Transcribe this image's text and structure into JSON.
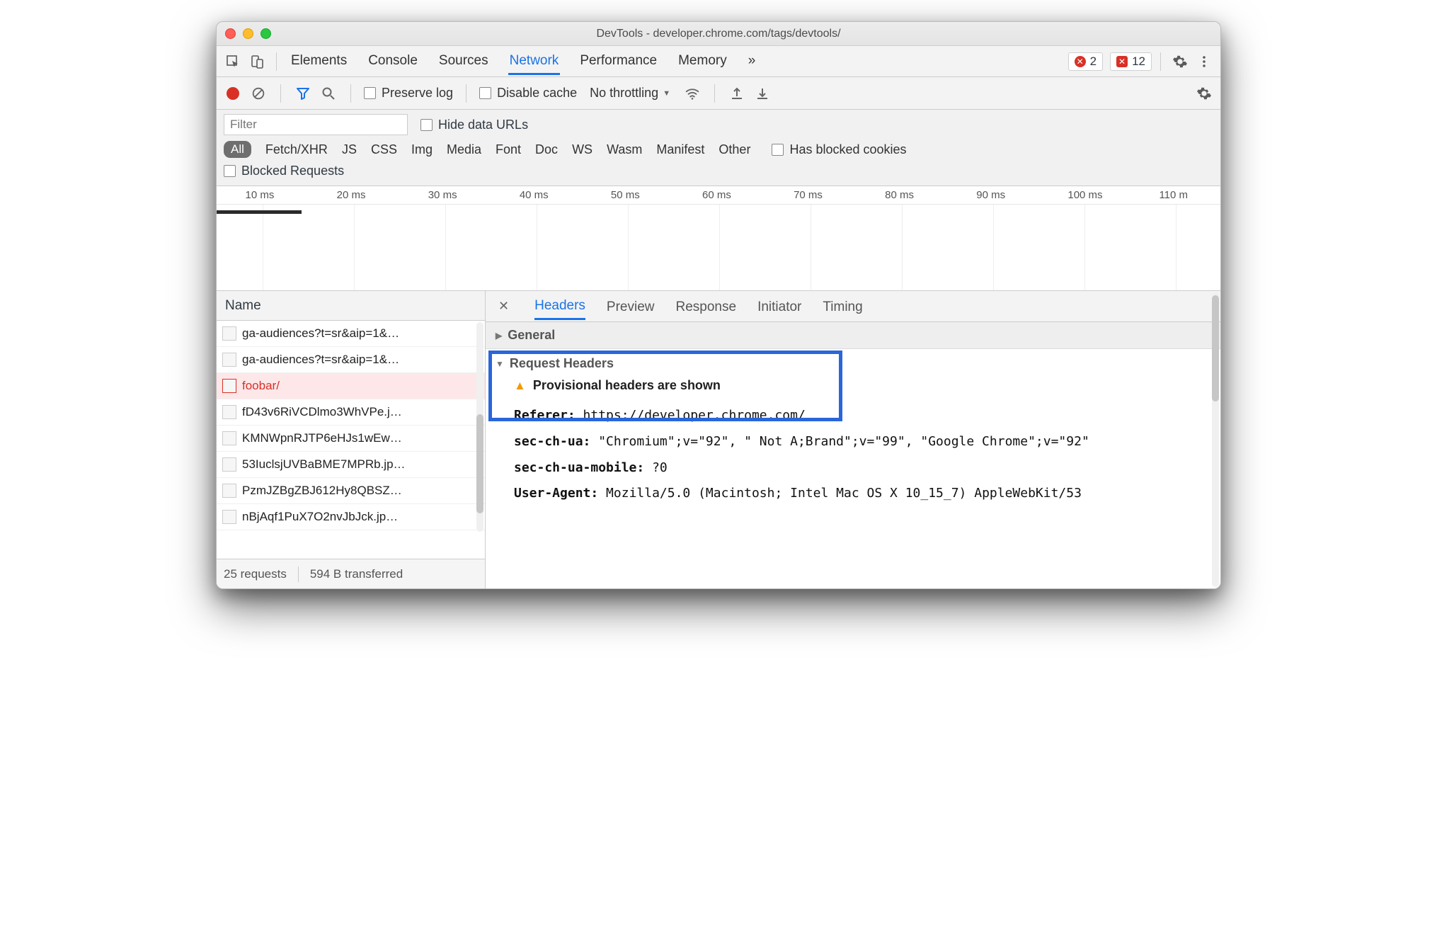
{
  "window": {
    "title": "DevTools - developer.chrome.com/tags/devtools/"
  },
  "topTabs": {
    "items": [
      "Elements",
      "Console",
      "Sources",
      "Network",
      "Performance",
      "Memory"
    ],
    "activeIndex": 3,
    "overflow": "»",
    "errors": "2",
    "warnings": "12"
  },
  "netToolbar": {
    "preserveLog": "Preserve log",
    "disableCache": "Disable cache",
    "throttling": "No throttling"
  },
  "filter": {
    "placeholder": "Filter",
    "hideDataUrls": "Hide data URLs",
    "types": [
      "All",
      "Fetch/XHR",
      "JS",
      "CSS",
      "Img",
      "Media",
      "Font",
      "Doc",
      "WS",
      "Wasm",
      "Manifest",
      "Other"
    ],
    "hasBlockedCookies": "Has blocked cookies",
    "blockedRequests": "Blocked Requests"
  },
  "overview": {
    "ticks": [
      "10 ms",
      "20 ms",
      "30 ms",
      "40 ms",
      "50 ms",
      "60 ms",
      "70 ms",
      "80 ms",
      "90 ms",
      "100 ms",
      "110 m"
    ]
  },
  "requestList": {
    "header": "Name",
    "rows": [
      {
        "name": "ga-audiences?t=sr&aip=1&…",
        "selected": false
      },
      {
        "name": "ga-audiences?t=sr&aip=1&…",
        "selected": false
      },
      {
        "name": "foobar/",
        "selected": true
      },
      {
        "name": "fD43v6RiVCDlmo3WhVPe.j…",
        "selected": false
      },
      {
        "name": "KMNWpnRJTP6eHJs1wEw…",
        "selected": false
      },
      {
        "name": "53IuclsjUVBaBME7MPRb.jp…",
        "selected": false
      },
      {
        "name": "PzmJZBgZBJ612Hy8QBSZ…",
        "selected": false
      },
      {
        "name": "nBjAqf1PuX7O2nvJbJck.jp…",
        "selected": false
      }
    ],
    "footer": {
      "count": "25 requests",
      "transferred": "594 B transferred"
    }
  },
  "details": {
    "tabs": [
      "Headers",
      "Preview",
      "Response",
      "Initiator",
      "Timing"
    ],
    "activeIndex": 0,
    "general": "General",
    "requestHeaders": {
      "title": "Request Headers",
      "provisional": "Provisional headers are shown",
      "headers": [
        {
          "k": "Referer:",
          "v": " https://developer.chrome.com/"
        },
        {
          "k": "sec-ch-ua:",
          "v": " \"Chromium\";v=\"92\", \" Not A;Brand\";v=\"99\", \"Google Chrome\";v=\"92\""
        },
        {
          "k": "sec-ch-ua-mobile:",
          "v": " ?0"
        },
        {
          "k": "User-Agent:",
          "v": " Mozilla/5.0 (Macintosh; Intel Mac OS X 10_15_7) AppleWebKit/53"
        }
      ]
    }
  }
}
